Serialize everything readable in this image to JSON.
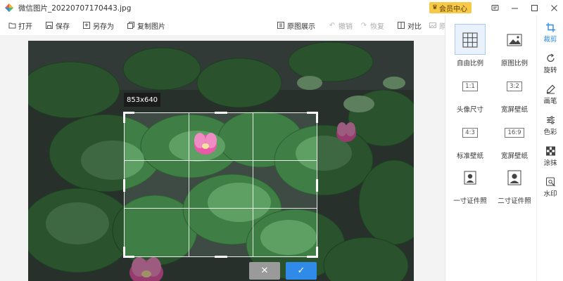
{
  "title_bar": {
    "file_name": "微信图片_20220707170443.jpg",
    "vip_label": "会员中心",
    "window_buttons": [
      "message-icon",
      "minimize-icon",
      "maximize-icon",
      "close-icon"
    ]
  },
  "toolbar": {
    "open": "打开",
    "save": "保存",
    "save_as": "另存为",
    "copy_image": "复制图片",
    "original_display": "原图展示",
    "undo": "撤销",
    "redo": "恢复",
    "compare": "对比",
    "original": "原图"
  },
  "editor": {
    "crop_size": "853x640",
    "cancel_icon": "✕",
    "confirm_icon": "✓"
  },
  "crop_presets": [
    {
      "label": "自由比例",
      "icon": "grid-icon",
      "active": true
    },
    {
      "label": "原图比例",
      "icon": "image-icon",
      "active": false
    },
    {
      "label": "头像尺寸",
      "ratio": "1:1",
      "active": false
    },
    {
      "label": "宽屏壁纸",
      "ratio": "3:2",
      "active": false
    },
    {
      "label": "标准壁纸",
      "ratio": "4:3",
      "active": false
    },
    {
      "label": "宽屏壁纸",
      "ratio": "16:9",
      "active": false
    },
    {
      "label": "一寸证件照",
      "icon": "id-photo-icon",
      "active": false
    },
    {
      "label": "二寸证件照",
      "icon": "id-photo-icon",
      "active": false
    }
  ],
  "tool_rail": [
    {
      "label": "裁剪",
      "icon": "crop-icon",
      "active": true
    },
    {
      "label": "旋转",
      "icon": "rotate-icon",
      "active": false
    },
    {
      "label": "画笔",
      "icon": "brush-icon",
      "active": false
    },
    {
      "label": "色彩",
      "icon": "sliders-icon",
      "active": false
    },
    {
      "label": "涂抹",
      "icon": "mosaic-icon",
      "active": false
    },
    {
      "label": "水印",
      "icon": "watermark-icon",
      "active": false
    }
  ],
  "colors": {
    "accent": "#2f8ae8",
    "vip": "#f7c948"
  }
}
